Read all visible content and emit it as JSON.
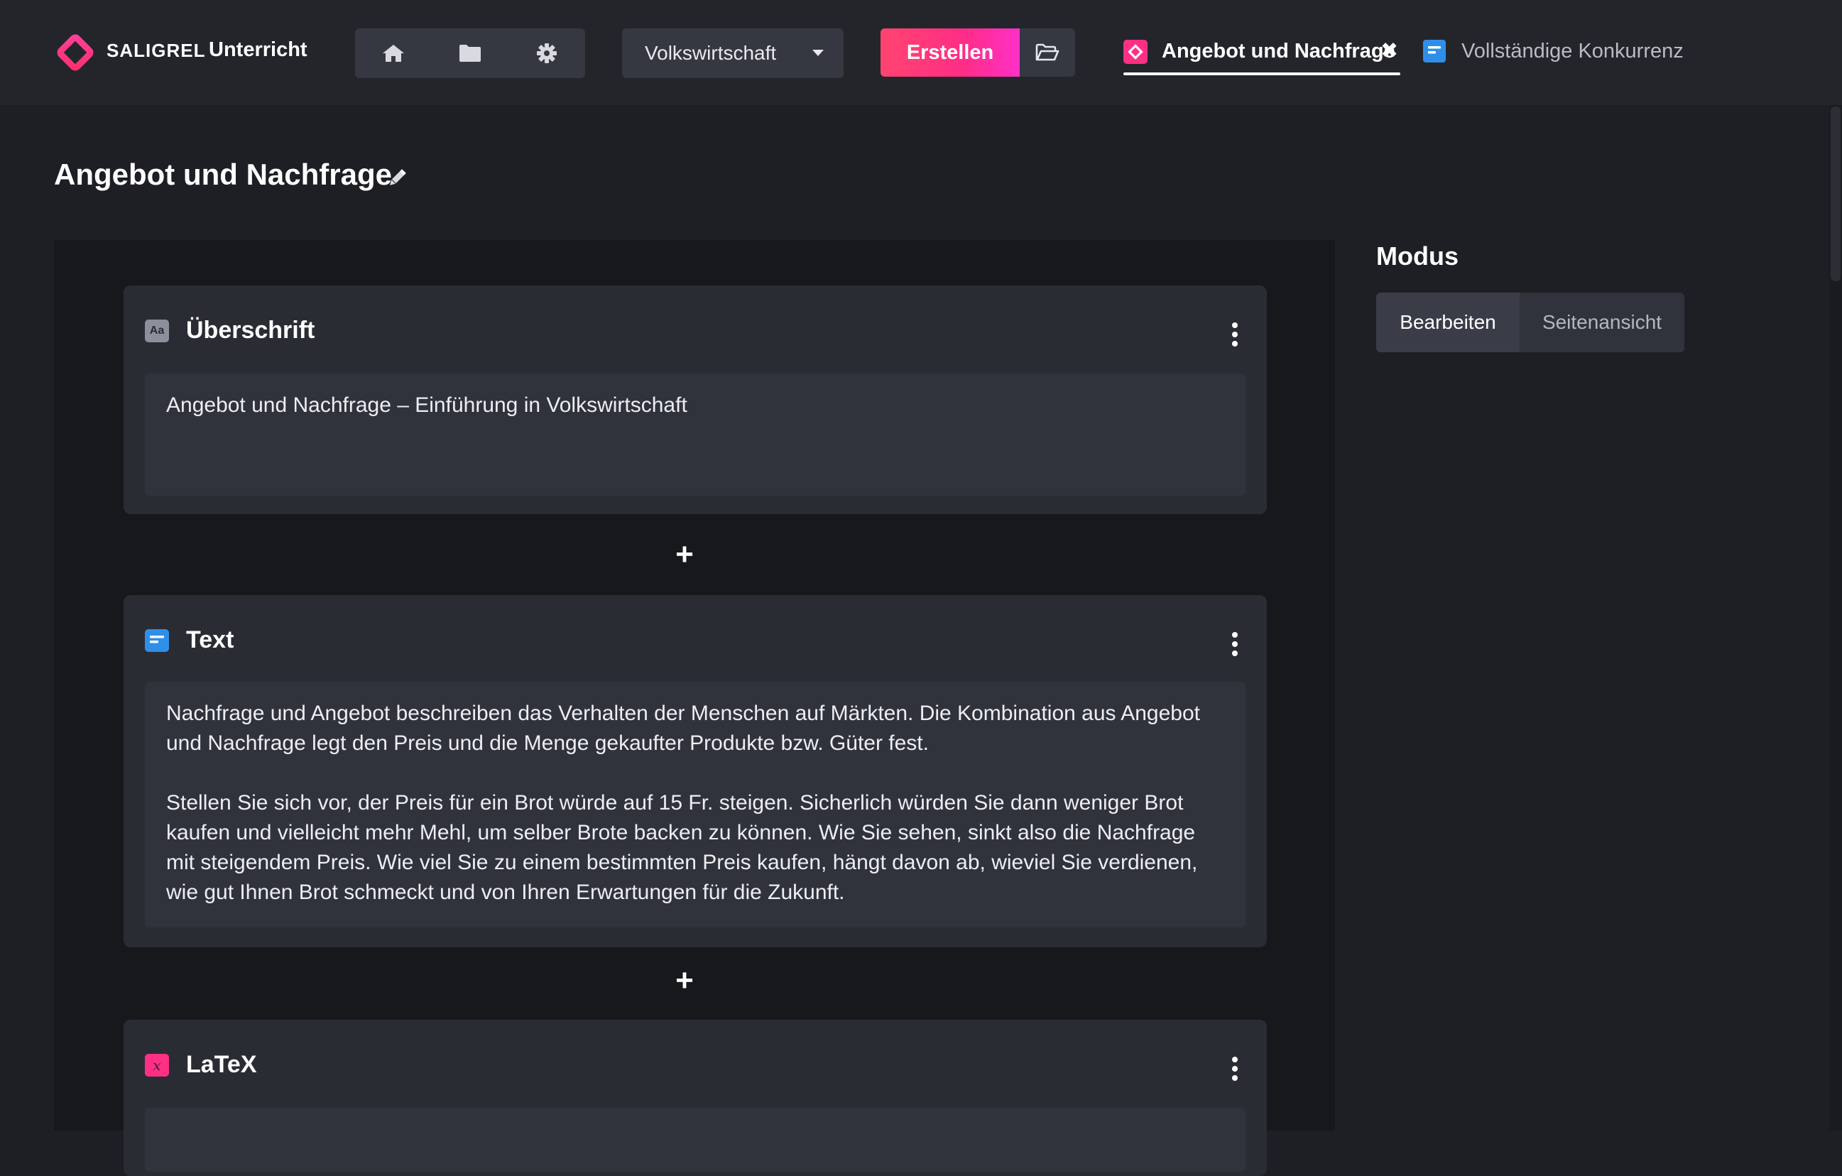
{
  "app": {
    "brand": "SALIGREL",
    "brand_sub": "Unterricht"
  },
  "toolbar": {
    "icons": [
      "home-icon",
      "folder-icon",
      "gear-icon"
    ],
    "subject_select": "Volkswirtschaft",
    "create_label": "Erstellen",
    "open_icon": "folder-open-icon"
  },
  "tabs": [
    {
      "label": "Angebot und Nachfrage",
      "active": true,
      "icon": "app-logo-icon",
      "close": "✖"
    },
    {
      "label": "Vollständige Konkurrenz",
      "active": false,
      "icon": "text-block-icon"
    }
  ],
  "page": {
    "title": "Angebot und Nachfrage"
  },
  "blocks": [
    {
      "type": "heading",
      "icon": "Aa",
      "title": "Überschrift",
      "content": "Angebot und Nachfrage – Einführung in Volkswirtschaft"
    },
    {
      "type": "text",
      "title": "Text",
      "paragraphs": [
        "Nachfrage und Angebot beschreiben das Verhalten der Menschen auf Märkten. Die Kombination aus Angebot und Nachfrage legt den Preis und die Menge gekaufter Produkte bzw. Güter fest.",
        "Stellen Sie sich vor, der Preis für ein Brot würde auf 15 Fr. steigen. Sicherlich würden Sie dann weniger Brot kaufen und vielleicht mehr Mehl, um selber Brote backen zu können. Wie Sie sehen, sinkt also die Nachfrage mit steigendem Preis. Wie viel Sie zu einem bestimmten Preis kaufen, hängt davon ab, wieviel Sie verdienen, wie gut Ihnen Brot schmeckt und von Ihren Erwartungen für die Zukunft."
      ]
    },
    {
      "type": "latex",
      "icon": "x",
      "title": "LaTeX"
    }
  ],
  "add_block_symbol": "+",
  "sidebar": {
    "mode_title": "Modus",
    "modes": [
      "Bearbeiten",
      "Seitenansicht"
    ],
    "active_mode": "Bearbeiten"
  },
  "colors": {
    "accent": "#ff2f86",
    "text_block_blue": "#2f8fe8",
    "background": "#1e1f24",
    "block": "#2a2c33"
  }
}
